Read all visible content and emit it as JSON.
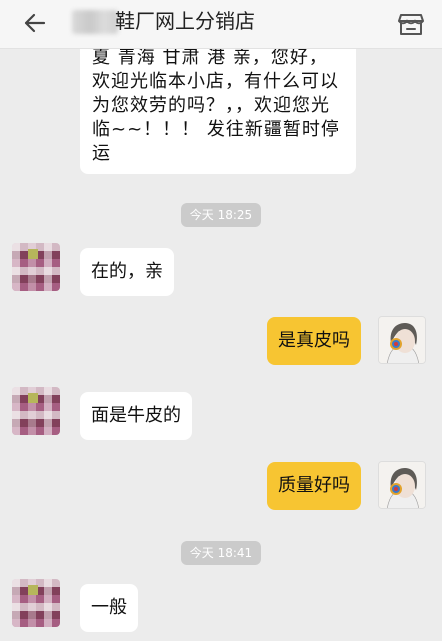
{
  "header": {
    "title": "鞋厂网上分销店",
    "back_icon": "arrow-left-icon",
    "store_icon": "store-icon"
  },
  "messages": {
    "top_partial_lines": [
      "夏  青海  甘肃  港 亲，您好，",
      "欢迎光临本小店，有什么可以",
      "为您效劳的吗？，，欢迎您光",
      "临~~！！！ 发往新疆暂时停",
      "运"
    ],
    "time1": "今天 18:25",
    "seller_msg1": "在的，亲",
    "user_msg1": "是真皮吗",
    "seller_msg2": "面是牛皮的",
    "user_msg2": "质量好吗",
    "time2": "今天 18:41",
    "seller_msg3": "一般"
  },
  "colors": {
    "background": "#ececec",
    "header_bg": "#f6f6f6",
    "user_bubble": "#f7c532",
    "seller_bubble": "#ffffff",
    "time_pill": "#cbcbcb"
  }
}
